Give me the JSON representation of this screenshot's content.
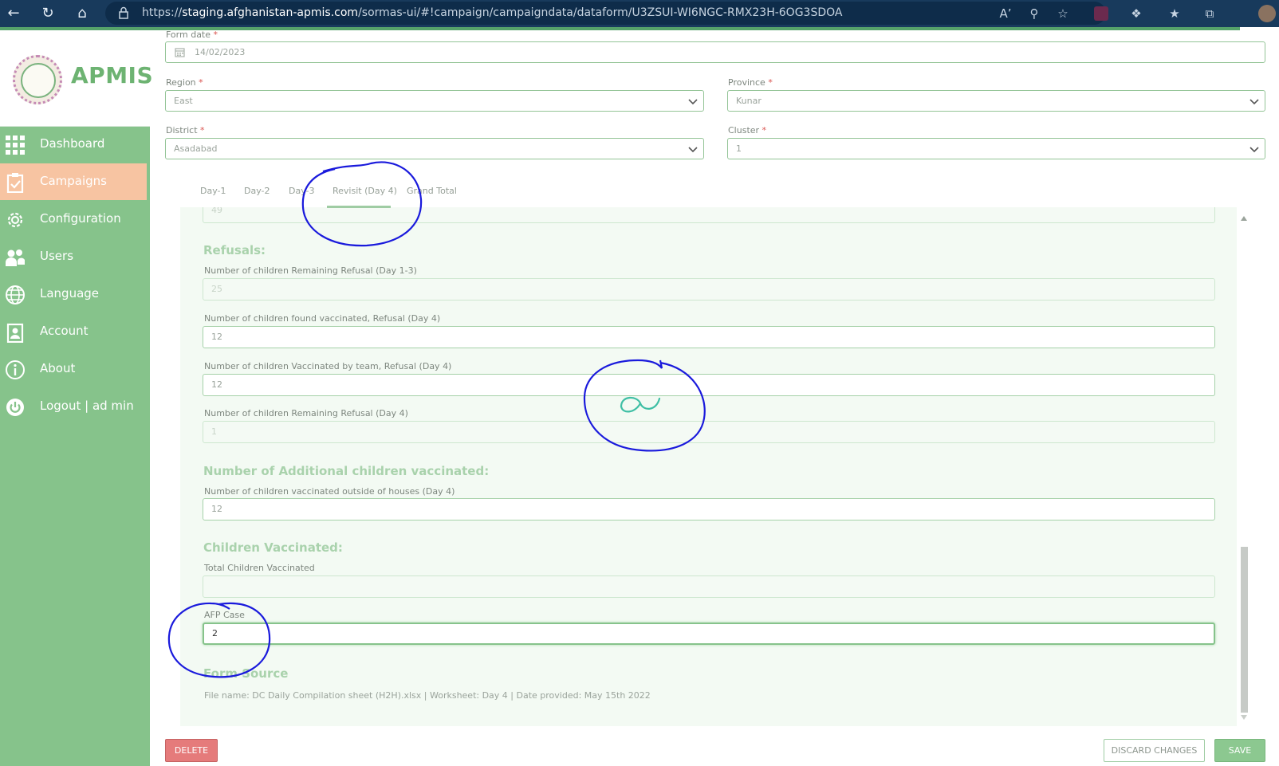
{
  "browser": {
    "url_prefix": "https://",
    "url_host": "staging.afghanistan-apmis.com",
    "url_path": "/sormas-ui/#!campaign/campaigndata/dataform/U3ZSUI-WI6NGC-RMX23H-6OG3SDOA"
  },
  "app": {
    "logo_text": "APMIS"
  },
  "sidebar": {
    "items": [
      {
        "label": "Dashboard",
        "icon": "grid-icon"
      },
      {
        "label": "Campaigns",
        "icon": "clipboard-check-icon"
      },
      {
        "label": "Configuration",
        "icon": "gear-icon"
      },
      {
        "label": "Users",
        "icon": "users-icon"
      },
      {
        "label": "Language",
        "icon": "globe-icon"
      },
      {
        "label": "Account",
        "icon": "id-badge-icon"
      },
      {
        "label": "About",
        "icon": "info-icon"
      },
      {
        "label": "Logout | ad min",
        "icon": "power-icon"
      }
    ],
    "active": "Campaigns"
  },
  "header_fields": {
    "form_date": {
      "label": "Form date",
      "value": "14/02/2023"
    },
    "region": {
      "label": "Region",
      "value": "East"
    },
    "province": {
      "label": "Province",
      "value": "Kunar"
    },
    "district": {
      "label": "District",
      "value": "Asadabad"
    },
    "cluster": {
      "label": "Cluster",
      "value": "1"
    },
    "required_marker": "*"
  },
  "tabs": [
    {
      "label": "Day-1"
    },
    {
      "label": "Day-2"
    },
    {
      "label": "Day-3"
    },
    {
      "label": "Revisit (Day 4)"
    },
    {
      "label": "Grand Total"
    }
  ],
  "active_tab": "Revisit (Day 4)",
  "form": {
    "clipped_value": "49",
    "refusals_title": "Refusals:",
    "refusal_remaining_13": {
      "label": "Number of children Remaining Refusal (Day 1-3)",
      "value": "25"
    },
    "refusal_found_vacc": {
      "label": "Number of children found vaccinated, Refusal (Day 4)",
      "value": "12"
    },
    "refusal_vacc_team": {
      "label": "Number of children Vaccinated by team, Refusal (Day 4)",
      "value": "12"
    },
    "refusal_remaining_4": {
      "label": "Number of children Remaining Refusal (Day 4)",
      "value": "1"
    },
    "additional_title": "Number of Additional children vaccinated:",
    "outside_houses": {
      "label": "Number of children vaccinated outside of houses (Day 4)",
      "value": "12"
    },
    "children_vacc_title": "Children Vaccinated:",
    "total_vacc": {
      "label": "Total Children Vaccinated",
      "value": ""
    },
    "afp_case": {
      "label": "AFP Case",
      "value": "2"
    },
    "form_source_title": "Form Source",
    "form_source_text": "File name: DC Daily Compilation sheet (H2H).xlsx | Worksheet: Day 4 | Date provided: May 15th 2022"
  },
  "buttons": {
    "delete": "DELETE",
    "discard": "DISCARD CHANGES",
    "save": "SAVE"
  },
  "colors": {
    "sidebar": "#86c38b",
    "active_item": "#f7c4a2",
    "accent_green": "#86c38b",
    "delete_red": "#e57b7b",
    "annotation_blue": "#1a1adc",
    "browser_bar": "#183a5c"
  }
}
